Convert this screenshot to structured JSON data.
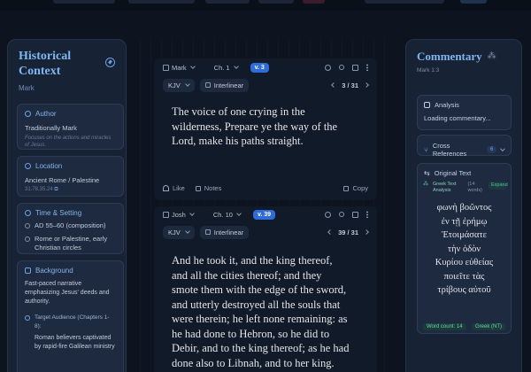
{
  "historical_context": {
    "title": "Historical Context",
    "subtitle": "Mark",
    "author": {
      "heading": "Author",
      "value": "Traditionally Mark",
      "note": "Focuses on the actions and miracles of Jesus."
    },
    "location": {
      "heading": "Location",
      "value": "Ancient Rome / Palestine",
      "coords": "31.78,35.24"
    },
    "time_setting": {
      "heading": "Time & Setting",
      "items": [
        "AD 55–60 (composition)",
        "Rome or Palestine, early Christian circles"
      ]
    },
    "background": {
      "heading": "Background",
      "text": "Fast-paced narrative emphasizing Jesus' deeds and authority.",
      "audience_label": "Target Audience (Chapters 1-8):",
      "audience_text": "Roman believers captivated by rapid-fire Galilean ministry"
    }
  },
  "verse_panels": [
    {
      "book": "Mark",
      "chapter": "Ch. 1",
      "verse": "v. 3",
      "translation": "KJV",
      "mode": "Interlinear",
      "page": "3 / 31",
      "text": "The voice of one crying in the wilderness, Prepare ye the way of the Lord, make his paths straight.",
      "like_label": "Like",
      "notes_label": "Notes",
      "copy_label": "Copy"
    },
    {
      "book": "Josh",
      "chapter": "Ch. 10",
      "verse": "v. 39",
      "translation": "KJV",
      "mode": "Interlinear",
      "page": "39 / 31",
      "text": "And he took it, and the king thereof, and all the cities thereof; and they smote them with the edge of the sword, and utterly destroyed all the souls that were therein; he left none remaining: as he had done to Hebron, so he did to Debir, and to the king thereof; as he had done also to Libnah, and to her king."
    }
  ],
  "commentary": {
    "title": "Commentary",
    "reference": "Mark 1:3",
    "analysis": {
      "heading": "Analysis",
      "status": "Loading commentary..."
    },
    "cross_references": {
      "heading": "Cross References",
      "count": "6"
    },
    "original_text": {
      "heading": "Original Text",
      "source": "Greek Text Analysis",
      "words": "(14 words)",
      "expand": "Expand",
      "lines": [
        "φωνὴ βοῶντος",
        "ἐν τῇ ἐρήμῳ",
        "Ἑτοιμάσατε",
        "τὴν ὁδὸν",
        "Κυρίου εὐθείας",
        "ποιεῖτε τὰς",
        "τρίβους αὐτοῦ"
      ],
      "word_count": "Word count: 14",
      "language": "Greek (NT)"
    }
  },
  "colors": {
    "accent": "#2f6bd9",
    "heading_blue": "#7fb6f0",
    "panel": "#172235",
    "greek_green": "#4dc3a0"
  }
}
